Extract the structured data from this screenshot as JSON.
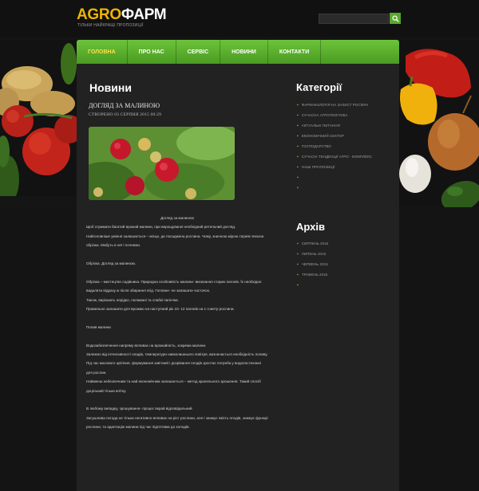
{
  "header": {
    "logo_part1": "AGRO",
    "logo_part2": "ФАРМ",
    "tagline": "ТІЛЬКИ НАЙКРАЩІ ПРОПОЗИЦІЇ",
    "search": {
      "placeholder": ""
    },
    "search_icon": "search-icon"
  },
  "nav": {
    "items": [
      {
        "label": "ГОЛОВНА",
        "active": true
      },
      {
        "label": "ПРО НАС"
      },
      {
        "label": "СЕРВІС"
      },
      {
        "label": "НОВИНИ"
      },
      {
        "label": "КОНТАКТИ"
      }
    ]
  },
  "main": {
    "heading": "Новини",
    "post": {
      "title": "ДОГЛЯД ЗА МАЛИНОЮ",
      "meta": "СТВОРЕНО 03 СЕРПНЯ 2015 00:29",
      "paragraphs": [
        "Догляд за малиною",
        "Щоб отримати багатий врожай малини, при вирощуванні необхідний ретельний догляд.",
        "Найголовніше уміння залишається – місце, де посаджена рослина. Чому, значною мірою сприяє вчасна обрізка. Мабуть в неї і почнемо.",
        "",
        "Обрізка. Догляд за малиною.",
        "",
        "Обрізка – мистецтво садівника. Природна особливість малини- висихання старих пагонів. Їх необхідно видаляти відразу ж після збирання ягід. Головне- не залишати частачок.",
        "Також, вирізають нерідко, поламані та слабкі пагінчки.",
        "Правильно залишити для врожаю на наступний рік 10- 12 пагонів на 1 п.метр рослини.",
        "",
        "Полив малини",
        "",
        "Водозабезпечення напряму впливає на врожайність, зокрема малини.",
        "Залежно від інтенсивності опадів, температури навколишнього повітря, визначається необхідність поливу.",
        "Під час масового цвітіння, формування зав'язей і дозрівання плодів зростає потреба у водопостачанні для рослин.",
        "Найменш небезпечним та най економічним залишається – метод крапельного зрошення. Такий спосіб доцільний тільки влітку.",
        "",
        "В любому випадку, зрошування- процес вкрай відповідальний.",
        " Засушлива погода не тільки негативно впливає на ріст рослини, але і знижує якість плодів, знижує функції рослини, та адаптацію малини під час підготовки до холодів."
      ]
    }
  },
  "sidebar": {
    "categories_heading": "Категорії",
    "categories": [
      "ФАРМАКОЛОГІЯ НА ЗАХИСТ РОСЛИН",
      "СУЧАСНА АГРОПОЛІТИКА",
      "АКТУАЛЬНІ ПИТАННЯ",
      "ЕКОНОМІЧНИЙ СЕКТОР",
      "ГОСПОДАРСТВО",
      "СУЧАСНІ ТЕНДЕНЦІЇ АГРО - КОМПЛЕКС",
      "НАШІ ПРОПОЗИЦІЇ",
      "",
      ""
    ],
    "archive_heading": "Архів",
    "archive": [
      "СЕРПЕНЬ 2015",
      "ЛИПЕНЬ 2015",
      "ЧЕРВЕНЬ 2015",
      "ТРАВЕНЬ 2015",
      ""
    ]
  },
  "colors": {
    "accent_green": "#57a82c",
    "logo_yellow": "#f0b400",
    "nav_active": "#ffe14a"
  }
}
